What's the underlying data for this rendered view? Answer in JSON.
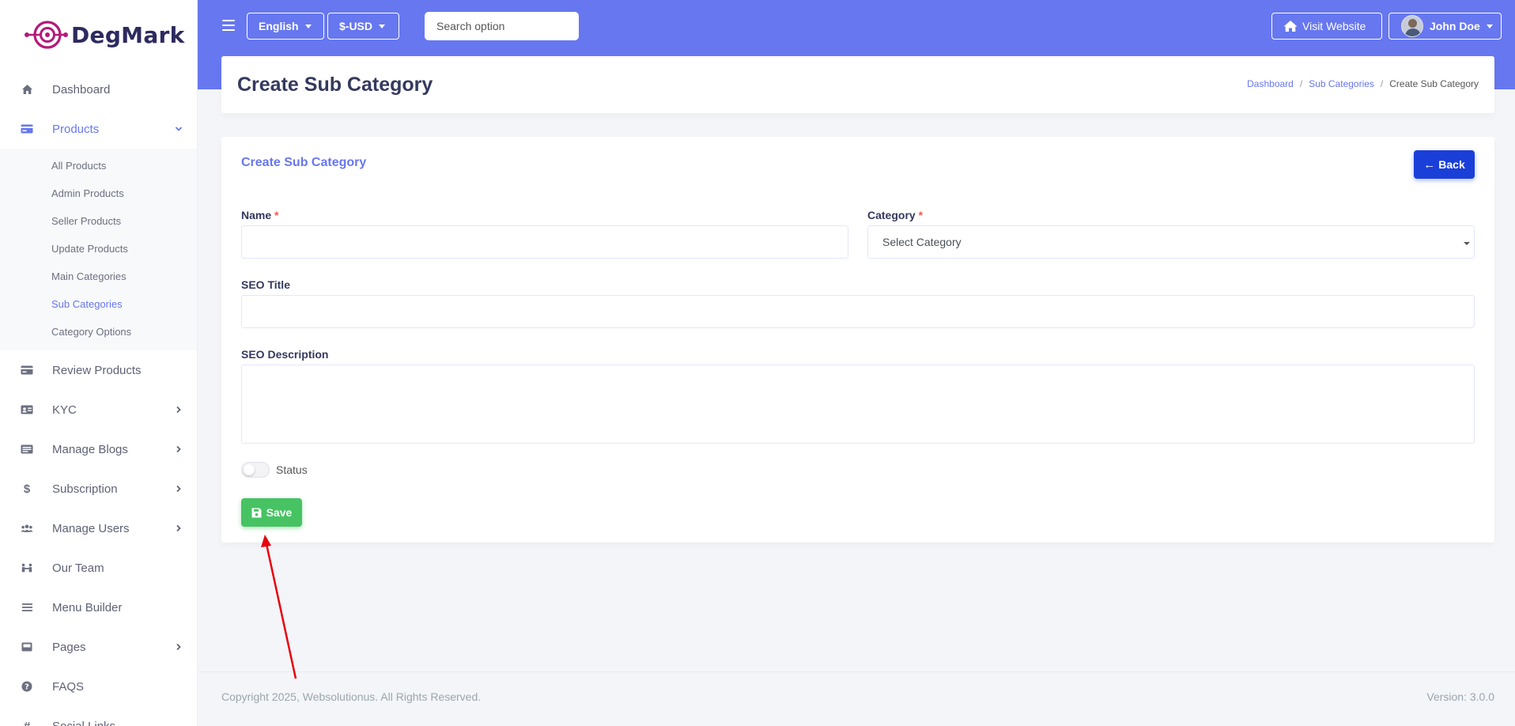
{
  "brand": {
    "name": "DegMark"
  },
  "sidebar": {
    "items": [
      {
        "label": "Dashboard",
        "icon": "home-icon"
      },
      {
        "label": "Products",
        "icon": "card-icon",
        "active": true,
        "expanded": true,
        "children": [
          {
            "label": "All Products"
          },
          {
            "label": "Admin Products"
          },
          {
            "label": "Seller Products"
          },
          {
            "label": "Update Products"
          },
          {
            "label": "Main Categories"
          },
          {
            "label": "Sub Categories",
            "active": true
          },
          {
            "label": "Category Options"
          }
        ]
      },
      {
        "label": "Review Products",
        "icon": "card-icon"
      },
      {
        "label": "KYC",
        "icon": "id-card-icon",
        "has_children": true
      },
      {
        "label": "Manage Blogs",
        "icon": "newspaper-icon",
        "has_children": true
      },
      {
        "label": "Subscription",
        "icon": "dollar-icon",
        "has_children": true
      },
      {
        "label": "Manage Users",
        "icon": "users-icon",
        "has_children": true
      },
      {
        "label": "Our Team",
        "icon": "team-icon"
      },
      {
        "label": "Menu Builder",
        "icon": "bars-icon"
      },
      {
        "label": "Pages",
        "icon": "page-icon",
        "has_children": true
      },
      {
        "label": "FAQS",
        "icon": "question-icon"
      },
      {
        "label": "Social Links",
        "icon": "hash-icon"
      }
    ]
  },
  "topbar": {
    "language": "English",
    "currency": "$-USD",
    "search_placeholder": "Search option",
    "visit_website": "Visit Website",
    "user_name": "John Doe"
  },
  "header": {
    "title": "Create Sub Category",
    "breadcrumb": [
      "Dashboard",
      "Sub Categories",
      "Create Sub Category"
    ]
  },
  "form": {
    "card_title": "Create Sub Category",
    "back_label": "Back",
    "name_label": "Name",
    "required_mark": "*",
    "name_value": "",
    "category_label": "Category",
    "category_selected": "Select Category",
    "seo_title_label": "SEO Title",
    "seo_title_value": "",
    "seo_description_label": "SEO Description",
    "seo_description_value": "",
    "status_label": "Status",
    "status_on": false,
    "save_label": "Save"
  },
  "footer": {
    "copyright": "Copyright 2025, Websolutionus. All Rights Reserved.",
    "version": "Version: 3.0.0"
  },
  "colors": {
    "primary": "#6777ef",
    "back_button": "#1a3fd8",
    "save_button": "#47c363",
    "required": "#fc544b",
    "annotation_arrow": "#e8000b"
  }
}
